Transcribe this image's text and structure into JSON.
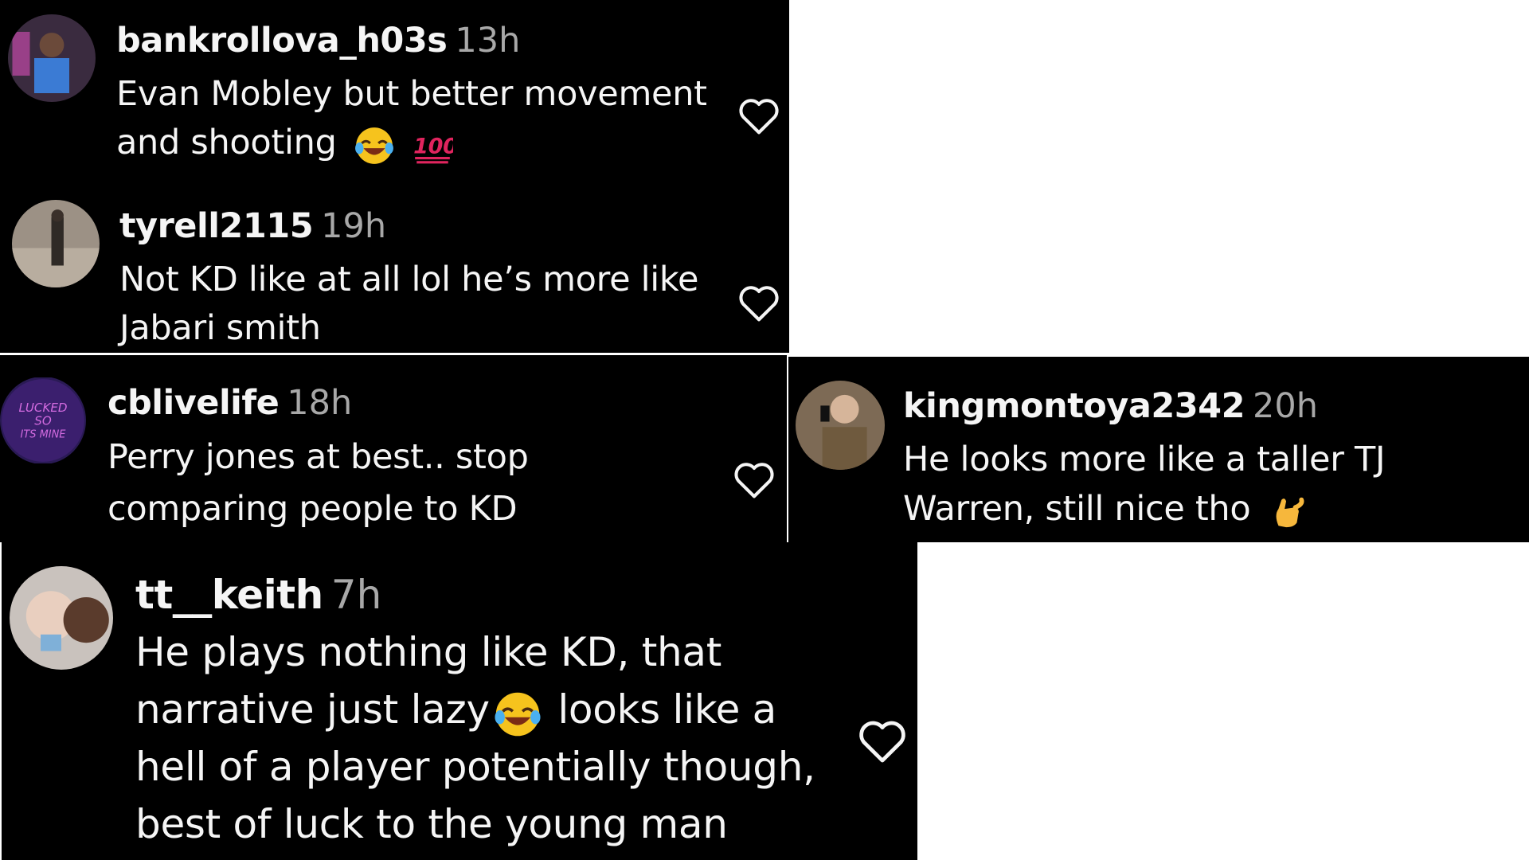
{
  "comments": [
    {
      "username": "bankrollova_h03s",
      "time": "13h",
      "lines": [
        "Evan Mobley but better movement",
        "and shooting"
      ],
      "emoji_names": [
        "laughing-tears-emoji",
        "hundred-points-emoji"
      ]
    },
    {
      "username": "tyrell2115",
      "time": "19h",
      "lines": [
        "Not KD like at all lol he’s more like",
        "Jabari smith"
      ]
    },
    {
      "username": "cblivelife",
      "time": "18h",
      "lines": [
        "Perry jones at best.. stop",
        "comparing people to KD"
      ]
    },
    {
      "username": "kingmontoya2342",
      "time": "20h",
      "lines": [
        "He looks more like a taller TJ",
        "Warren, still nice tho"
      ],
      "emoji_names": [
        "call-me-hand-emoji"
      ]
    },
    {
      "username": "tt__keith",
      "time": "7h",
      "lines": [
        "He plays nothing like KD, that",
        "narrative just lazy",
        " looks like a",
        "hell of a player potentially though,",
        "best of luck to the young man"
      ],
      "emoji_names": [
        "laughing-tears-emoji"
      ]
    }
  ],
  "colors": {
    "panel_bg": "#000000",
    "username": "#f5f5f5",
    "timestamp": "#a8a8a8",
    "comment_text": "#f5f5f5",
    "heart_outline": "#f5f5f5",
    "page_bg": "#ffffff"
  },
  "icons": {
    "like": "heart-outline-icon"
  }
}
